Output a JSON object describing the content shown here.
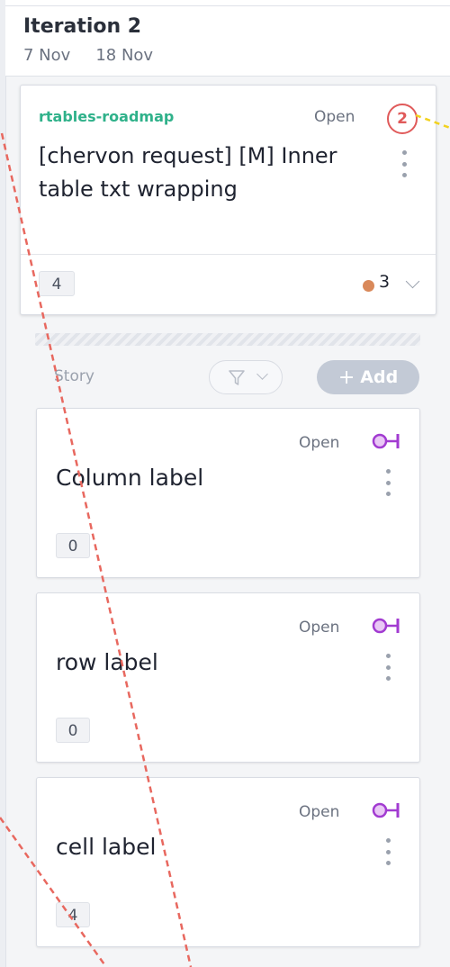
{
  "iteration": {
    "title": "Iteration 2",
    "start_date": "7 Nov",
    "end_date": "18 Nov"
  },
  "feature": {
    "project": "rtables-roadmap",
    "status": "Open",
    "dependency_count": "2",
    "title": "[chervon request] [M] Inner table txt wrapping",
    "child_count": "4",
    "points": "3",
    "points_color": "#d9895a"
  },
  "stories_section": {
    "label": "Story",
    "add_label": "Add",
    "filter_icon": "filter-icon",
    "items": [
      {
        "status": "Open",
        "title": "Column label",
        "count": "0",
        "type_icon": "story-type-icon",
        "type_color": "#a23bd1"
      },
      {
        "status": "Open",
        "title": "row label",
        "count": "0",
        "type_icon": "story-type-icon",
        "type_color": "#a23bd1"
      },
      {
        "status": "Open",
        "title": "cell label",
        "count": "4",
        "type_icon": "story-type-icon",
        "type_color": "#a23bd1"
      }
    ]
  },
  "colors": {
    "project": "#2fb18a",
    "dependency_badge": "#e05a5a",
    "dependency_line_red": "#e8685f",
    "dependency_line_yellow": "#f2d21f",
    "add_button": "#c3cad6"
  }
}
